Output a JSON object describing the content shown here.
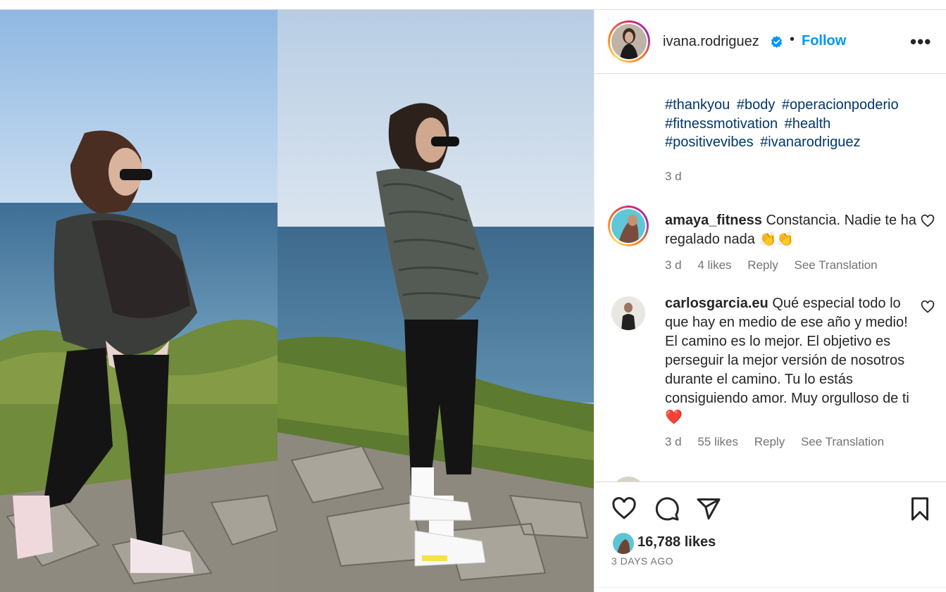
{
  "post": {
    "username": "ivana.rodriguez",
    "follow_label": "Follow",
    "separator": "•",
    "more_label": "•••",
    "caption_cut": "",
    "hashtags": [
      "#thankyou",
      "#body",
      "#operacionpoderio",
      "#fitnessmotivation",
      "#health",
      "#positivevibes",
      "#ivanarodriguez"
    ],
    "caption_age": "3 d"
  },
  "comments": [
    {
      "username": "amaya_fitness",
      "text": "Constancia. Nadie te ha regalado nada 👏👏",
      "age": "3 d",
      "likes": "4 likes",
      "reply": "Reply",
      "translate": "See Translation"
    },
    {
      "username": "carlosgarcia.eu",
      "text": "Qué especial todo lo que hay en medio de ese año y medio! El camino es lo mejor. El objetivo es perseguir la mejor versión de nosotros durante el camino. Tu lo estás consiguiendo amor. Muy orgulloso de ti ❤️",
      "age": "3 d",
      "likes": "55 likes",
      "reply": "Reply",
      "translate": "See Translation"
    }
  ],
  "footer": {
    "likes_count": "16,788 likes",
    "timestamp": "3 DAYS AGO"
  },
  "colors": {
    "link_blue": "#0095f6",
    "hashtag_blue": "#00376b",
    "muted": "#737373"
  },
  "icons": [
    "heart-icon",
    "comment-icon",
    "share-icon",
    "bookmark-icon",
    "verified-badge-icon",
    "more-options-icon"
  ]
}
